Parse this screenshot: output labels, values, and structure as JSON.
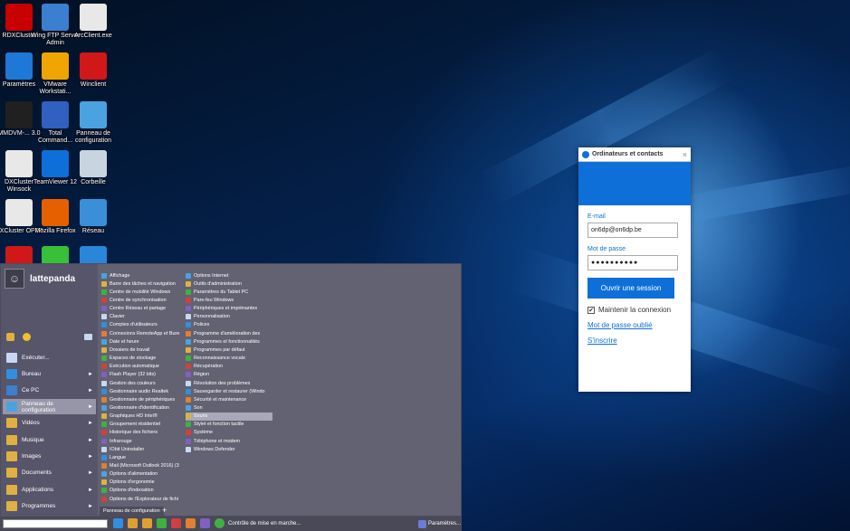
{
  "desktop_icons": [
    {
      "label": "RDXCluster",
      "icon": "rdx-cluster-icon",
      "color": "#c80000"
    },
    {
      "label": "Wing FTP Server Admin",
      "icon": "wing-ftp-icon",
      "color": "#3a7fd0"
    },
    {
      "label": "ArcClient.exe",
      "icon": "document-icon",
      "color": "#e8e8e8"
    },
    {
      "label": "Paramètres",
      "icon": "gear-icon",
      "color": "#1e78d6"
    },
    {
      "label": "VMware Workstati...",
      "icon": "vmware-icon",
      "color": "#f0a400"
    },
    {
      "label": "Winclient",
      "icon": "winclient-icon",
      "color": "#d01818"
    },
    {
      "label": "MMDVM-... 3.0",
      "icon": "dvr-icon",
      "color": "#202020"
    },
    {
      "label": "Total Command...",
      "icon": "total-commander-icon",
      "color": "#3060c0"
    },
    {
      "label": "Panneau de configuration",
      "icon": "control-panel-icon",
      "color": "#4aa3e0"
    },
    {
      "label": "DXCluster Winsock",
      "icon": "document-icon",
      "color": "#e8e8e8"
    },
    {
      "label": "TeamViewer 12",
      "icon": "teamviewer-icon",
      "color": "#0e6fd8"
    },
    {
      "label": "Corbeille",
      "icon": "recycle-bin-icon",
      "color": "#c8d4e0"
    },
    {
      "label": "DXCluster OP0P",
      "icon": "document-icon",
      "color": "#e8e8e8"
    },
    {
      "label": "Mozilla Firefox",
      "icon": "firefox-icon",
      "color": "#e66000"
    },
    {
      "label": "Réseau",
      "icon": "network-icon",
      "color": "#3a8fd8"
    },
    {
      "label": "",
      "icon": "winclient-icon",
      "color": "#d01818"
    },
    {
      "label": "",
      "icon": "green-app-icon",
      "color": "#38c038"
    },
    {
      "label": "",
      "icon": "blue-app-icon",
      "color": "#2a86d8"
    }
  ],
  "teamviewer": {
    "title": "Ordinateurs et contacts",
    "close": "×",
    "email_label": "E-mail",
    "email_value": "on6dp@on6dp.be",
    "password_label": "Mot de passe",
    "password_value": "●●●●●●●●●●",
    "login_button": "Ouvrir une session",
    "remember": "Maintenir la connexion",
    "remember_mark": "✔",
    "forgot": "Mot de passe oublié",
    "signup": "S'inscrire",
    "accent": "#0e6fd8"
  },
  "start_menu": {
    "user": "lattepanda",
    "left_items": [
      {
        "label": "Exécuter...",
        "arrow": ""
      },
      {
        "label": "Bureau",
        "arrow": "►"
      },
      {
        "label": "Ce PC",
        "arrow": "►"
      },
      {
        "label": "Panneau de configuration",
        "arrow": "►",
        "selected": true
      },
      {
        "label": "Vidéos",
        "arrow": "►"
      },
      {
        "label": "Musique",
        "arrow": "►"
      },
      {
        "label": "Images",
        "arrow": "►"
      },
      {
        "label": "Documents",
        "arrow": "►"
      },
      {
        "label": "Applications",
        "arrow": "►"
      },
      {
        "label": "Programmes",
        "arrow": "►"
      }
    ],
    "control_panel_col1": [
      "Affichage",
      "Barre des tâches et navigation",
      "Centre de mobilité Windows",
      "Centre de synchronisation",
      "Centre Réseau et partage",
      "Clavier",
      "Comptes d'utilisateurs",
      "Connexions RemoteApp et Bure",
      "Date et heure",
      "Dossiers de travail",
      "Espaces de stockage",
      "Exécution automatique",
      "Flash Player (32 bits)",
      "Gestion des couleurs",
      "Gestionnaire audio Realtek",
      "Gestionnaire de périphériques",
      "Gestionnaire d'identification",
      "Graphiques HD Intel®",
      "Groupement résidentiel",
      "Historique des fichiers",
      "Infrarouge",
      "IObit Uninstaller",
      "Langue",
      "Mail (Microsoft Outlook 2016) (3",
      "Options d'alimentation",
      "Options d'ergonomie",
      "Options d'indexation",
      "Options de l'Explorateur de fichi"
    ],
    "control_panel_col2": [
      "Options Internet",
      "Outils d'administration",
      "Paramètres du Tablet PC",
      "Pare-feu Windows",
      "Périphériques et imprimantes",
      "Personnalisation",
      "Polices",
      "Programme d'amélioration des",
      "Programmes et fonctionnalités",
      "Programmes par défaut",
      "Reconnaissance vocale",
      "Récupération",
      "Région",
      "Résolution des problèmes",
      "Sauvegarder et restaurer (Windo",
      "Sécurité et maintenance",
      "Son",
      "Souris",
      "Stylet et fonction tactile",
      "Système",
      "Téléphone et modem",
      "Windows Defender"
    ],
    "selected_cp": "Souris",
    "tab_label": "Panneau de configuration",
    "tab_plus": "+"
  },
  "taskbar": {
    "search_value": "",
    "window_label": "Contrôle de mise en marche...",
    "settings_label": "Paramètres..."
  }
}
